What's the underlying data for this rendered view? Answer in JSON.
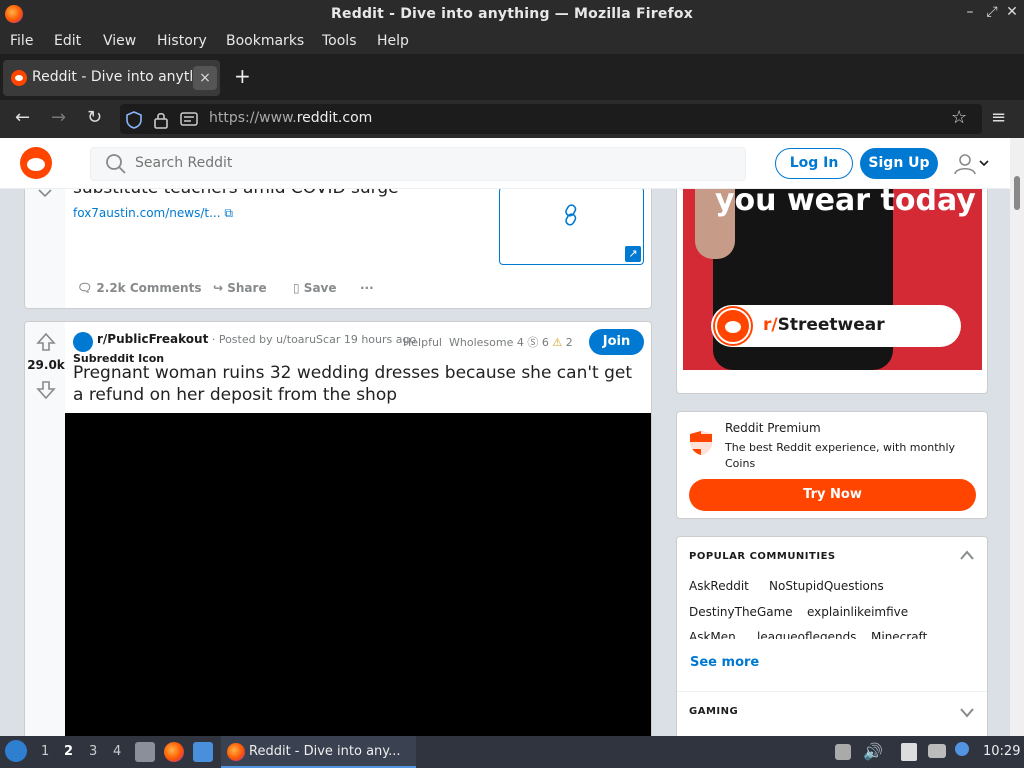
{
  "window": {
    "title": "Reddit - Dive into anything — Mozilla Firefox"
  },
  "menubar": [
    "File",
    "Edit",
    "View",
    "History",
    "Bookmarks",
    "Tools",
    "Help"
  ],
  "tab": {
    "label": "Reddit - Dive into anything",
    "close": "×",
    "new_tab": "+"
  },
  "navbar": {
    "url_prefix": "https://www.",
    "url_domain": "reddit.com"
  },
  "header": {
    "search_placeholder": "Search Reddit",
    "login": "Log In",
    "signup": "Sign Up"
  },
  "post1": {
    "title": "substitute teachers amid COVID surge",
    "link": "fox7austin.com/news/t...",
    "actions": {
      "comments": "2.2k Comments",
      "share": "Share",
      "save": "Save",
      "more": "···"
    }
  },
  "post2": {
    "score": "29.0k",
    "subreddit": "r/PublicFreakout",
    "subreddit_icon_alt": "Subreddit Icon",
    "posted_by": "· Posted by u/toaruScar 19 hours ago",
    "awards": {
      "helpful": "Helpful",
      "wholesome": "Wholesome",
      "count_a": "4",
      "count_b": "6",
      "count_c": "2"
    },
    "join": "Join",
    "title": "Pregnant woman ruins 32 wedding dresses because she can't get a refund on her deposit from the shop"
  },
  "ad": {
    "headline": "you wear today",
    "prefix": "r/",
    "subreddit": "Streetwear"
  },
  "premium": {
    "title": "Reddit Premium",
    "desc": "The best Reddit experience, with monthly Coins",
    "button": "Try Now"
  },
  "popular": {
    "heading": "POPULAR COMMUNITIES",
    "row1": [
      "AskReddit",
      "NoStupidQuestions"
    ],
    "row2": [
      "DestinyTheGame",
      "explainlikeimfive"
    ],
    "row3": [
      "AskMen",
      "leagueoflegends",
      "Minecraft"
    ],
    "see_more": "See more",
    "gaming": "GAMING"
  },
  "taskbar": {
    "workspaces": [
      "1",
      "2",
      "3",
      "4"
    ],
    "active_workspace": "2",
    "active_task": "Reddit - Dive into any...",
    "clock": "10:29"
  },
  "colors": {
    "accent": "#0079d3",
    "brand": "#ff4500"
  }
}
